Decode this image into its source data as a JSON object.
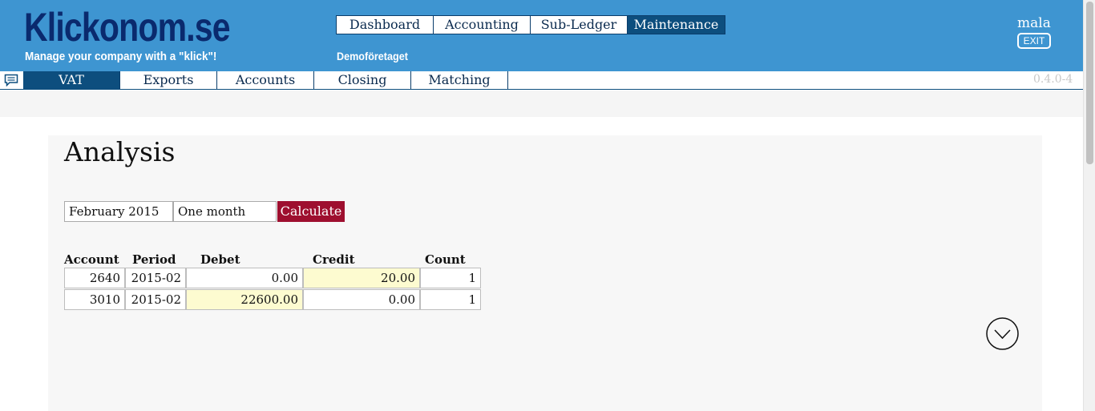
{
  "brand": {
    "logo": "Klickonom.se",
    "tagline": "Manage your company with a \"klick\"!"
  },
  "company_name": "Demoföretaget",
  "main_nav": [
    {
      "label": "Dashboard",
      "active": false
    },
    {
      "label": "Accounting",
      "active": false
    },
    {
      "label": "Sub-Ledger",
      "active": false
    },
    {
      "label": "Maintenance",
      "active": true
    }
  ],
  "user": {
    "name": "mala",
    "exit_label": "EXIT"
  },
  "sub_nav": [
    {
      "label": "VAT",
      "active": true
    },
    {
      "label": "Exports",
      "active": false
    },
    {
      "label": "Accounts",
      "active": false
    },
    {
      "label": "Closing",
      "active": false
    },
    {
      "label": "Matching",
      "active": false
    }
  ],
  "version": "0.4.0-4",
  "page": {
    "title": "Analysis",
    "period_field": "February 2015",
    "range_field": "One month",
    "calculate_label": "Calculate"
  },
  "table": {
    "headers": [
      "Account",
      "Period",
      "Debet",
      "Credit",
      "Count"
    ],
    "rows": [
      {
        "account": "2640",
        "period": "2015-02",
        "debet": "0.00",
        "credit": "20.00",
        "count": "1"
      },
      {
        "account": "3010",
        "period": "2015-02",
        "debet": "22600.00",
        "credit": "0.00",
        "count": "1"
      }
    ]
  },
  "icons": {
    "chat": "chat-icon",
    "scroll_down": "chevron-down-circle-icon"
  },
  "colors": {
    "header_bg": "#3e95d1",
    "active_tab": "#0d4e7e",
    "calc_button": "#9e0f2f",
    "highlight_cell": "#fdfbd0"
  }
}
